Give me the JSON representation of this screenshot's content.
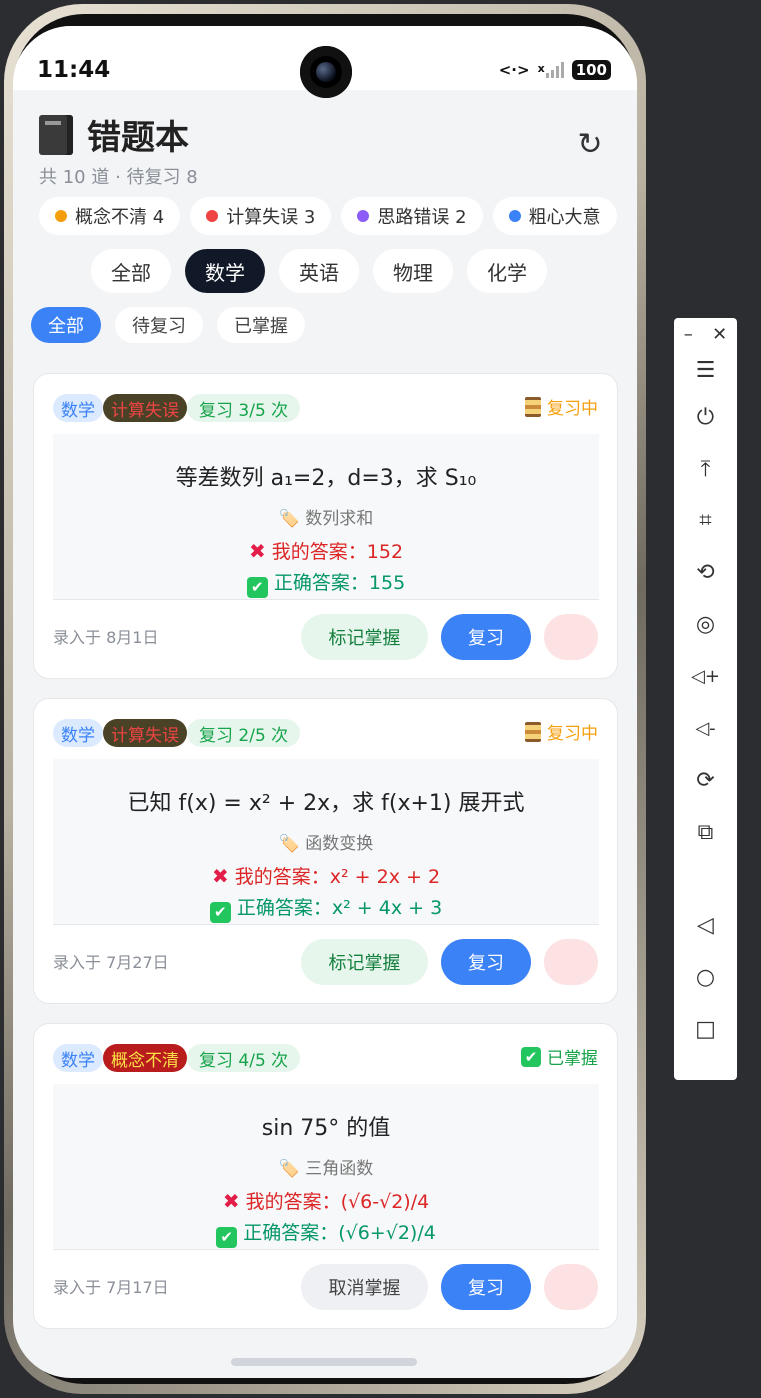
{
  "status_bar": {
    "time": "11:44",
    "network": "<·>",
    "signal_label": "x",
    "battery": "100"
  },
  "header": {
    "title": "错题本",
    "subtitle": "共 10 道 · 待复习 8",
    "refresh_icon": "↻"
  },
  "categories": [
    {
      "label": "概念不清 4",
      "color": "#f59e0b"
    },
    {
      "label": "计算失误 3",
      "color": "#ef4444"
    },
    {
      "label": "思路错误 2",
      "color": "#8b5cf6"
    },
    {
      "label": "粗心大意",
      "color": "#3b82f6"
    }
  ],
  "subject_tabs": [
    {
      "label": "全部",
      "active": false
    },
    {
      "label": "数学",
      "active": true
    },
    {
      "label": "英语",
      "active": false
    },
    {
      "label": "物理",
      "active": false
    },
    {
      "label": "化学",
      "active": false
    }
  ],
  "status_filters": [
    {
      "label": "全部",
      "active": true
    },
    {
      "label": "待复习",
      "active": false
    },
    {
      "label": "已掌握",
      "active": false
    }
  ],
  "cards": [
    {
      "subject": "数学",
      "error_type": "计算失误",
      "review": "复习 3/5 次",
      "status": "复习中",
      "question": "等差数列 a₁=2，d=3，求 S₁₀",
      "knowledge": "🏷️ 数列求和",
      "my_answer": "我的答案：152",
      "correct_answer": "正确答案：155",
      "date": "录入于 8月1日",
      "mark_label": "标记掌握",
      "review_label": "复习"
    },
    {
      "subject": "数学",
      "error_type": "计算失误",
      "review": "复习 2/5 次",
      "status": "复习中",
      "question": "已知 f(x) = x² + 2x，求 f(x+1) 展开式",
      "knowledge": "🏷️ 函数变换",
      "my_answer": "我的答案：x² + 2x + 2",
      "correct_answer": "正确答案：x² + 4x + 3",
      "date": "录入于 7月27日",
      "mark_label": "标记掌握",
      "review_label": "复习"
    },
    {
      "subject": "数学",
      "error_type": "概念不清",
      "review": "复习 4/5 次",
      "status": "已掌握",
      "question": "sin 75° 的值",
      "knowledge": "🏷️ 三角函数",
      "my_answer": "我的答案：(√6-√2)/4",
      "correct_answer": "正确答案：(√6+√2)/4",
      "date": "录入于 7月17日",
      "mark_label": "取消掌握",
      "review_label": "复习"
    }
  ],
  "toolbar": {
    "minimize": "–",
    "close": "✕",
    "icons": [
      "☰",
      "⏻",
      "⤒",
      "⌗",
      "⟲",
      "◎",
      "◁+",
      "◁-",
      "⟳",
      "⧉",
      "◁",
      "○",
      "□"
    ]
  }
}
